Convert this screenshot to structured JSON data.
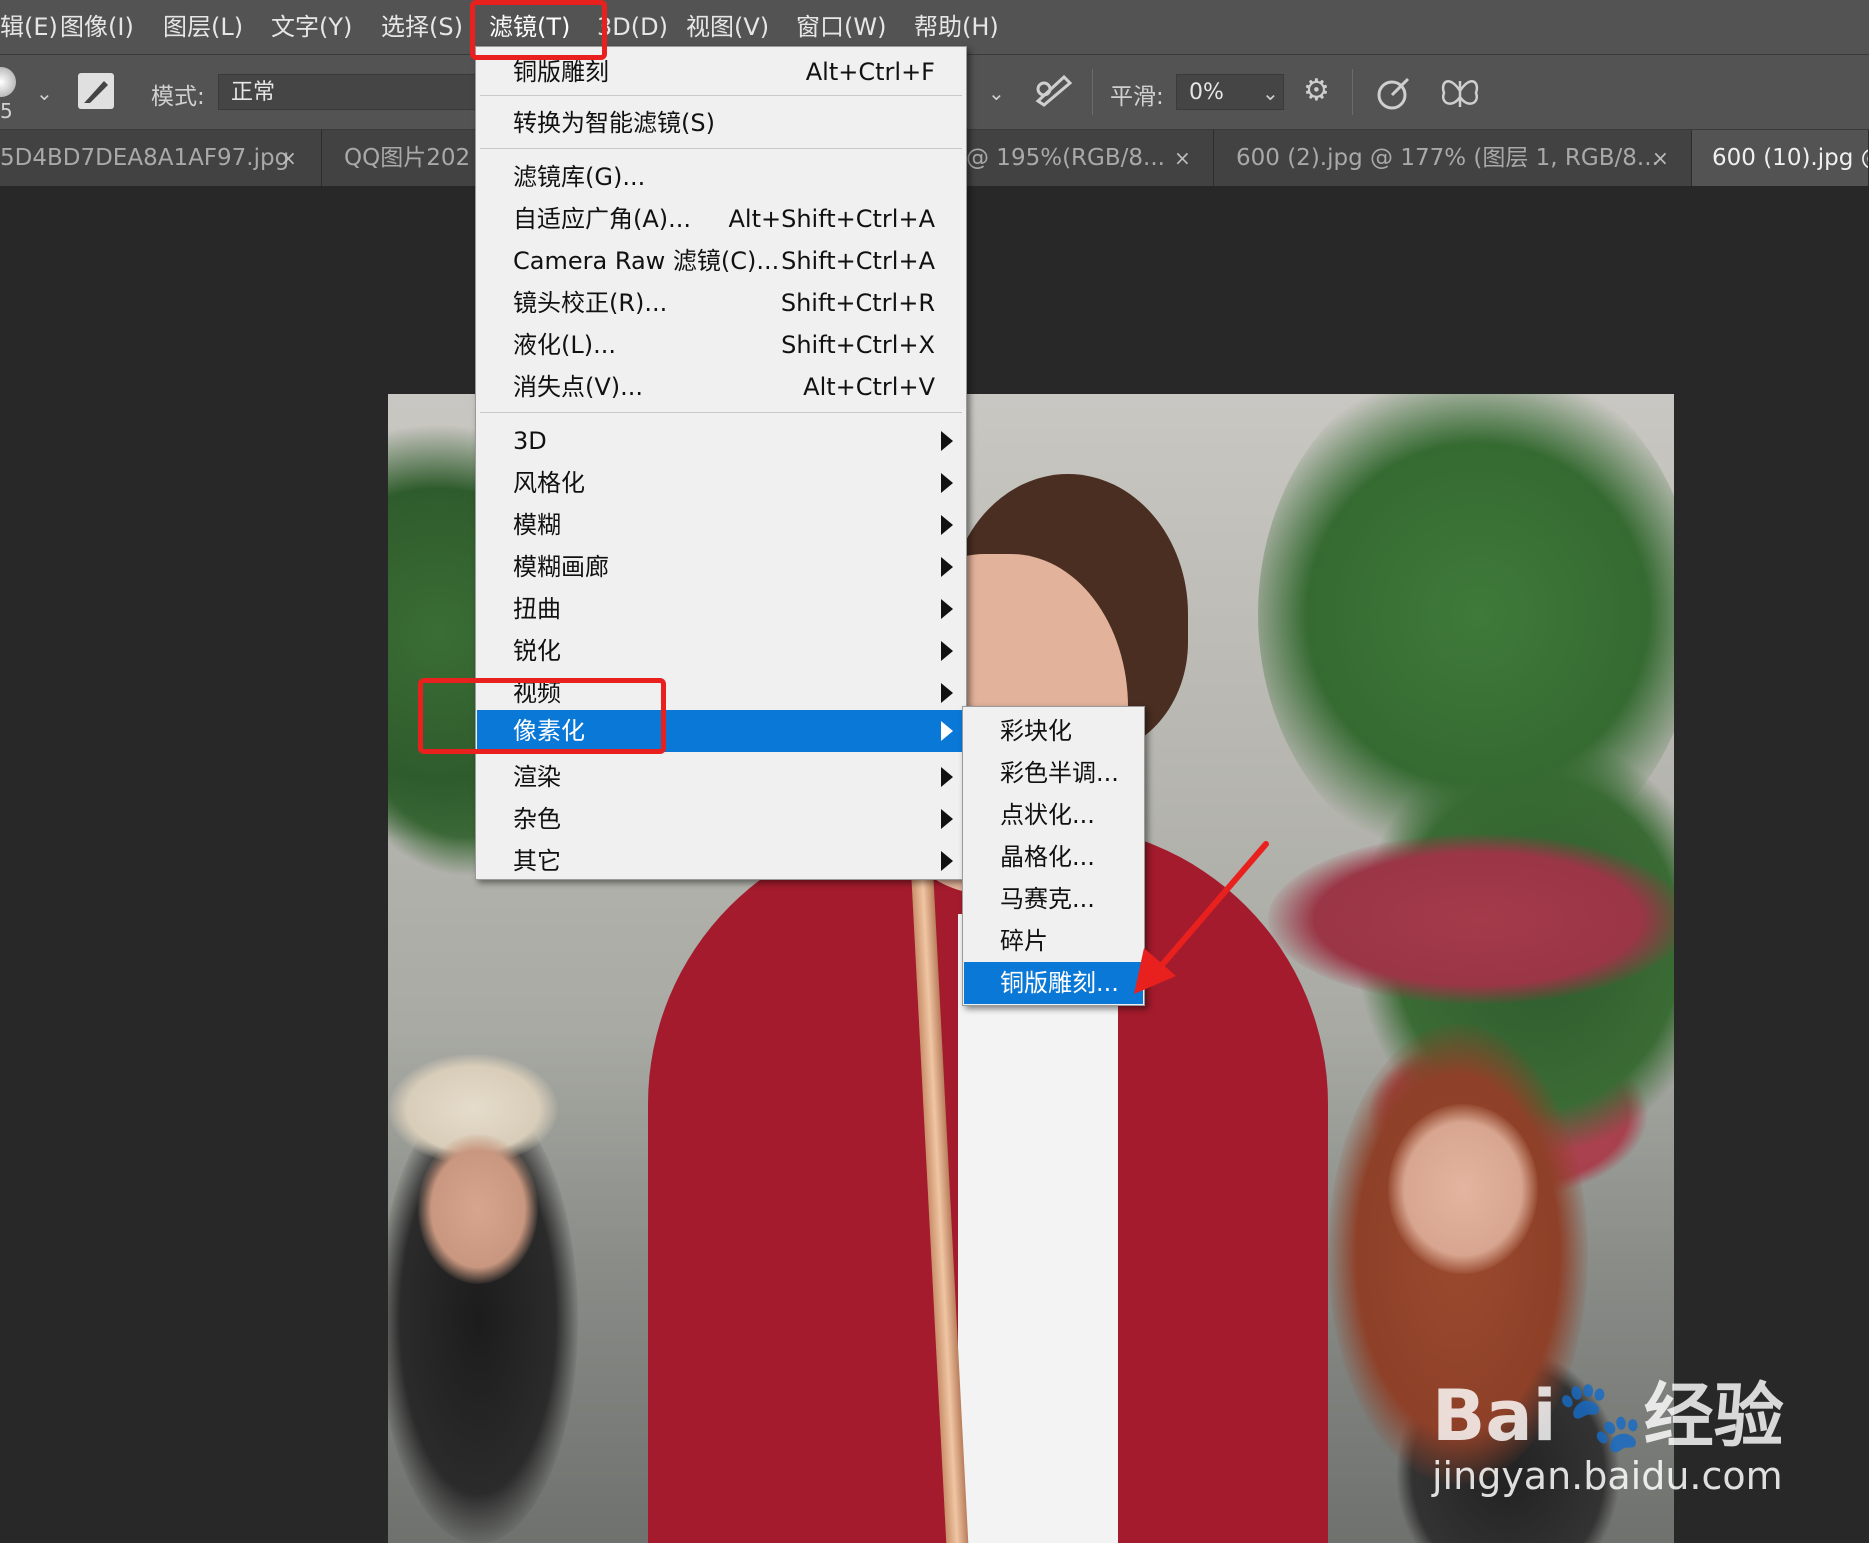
{
  "menubar": {
    "items": [
      {
        "label": "辑(E)"
      },
      {
        "label": "图像(I)"
      },
      {
        "label": "图层(L)"
      },
      {
        "label": "文字(Y)"
      },
      {
        "label": "选择(S)"
      },
      {
        "label": "滤镜(T)"
      },
      {
        "label": "3D(D)"
      },
      {
        "label": "视图(V)"
      },
      {
        "label": "窗口(W)"
      },
      {
        "label": "帮助(H)"
      }
    ]
  },
  "options": {
    "brush_size": "5",
    "mode_label": "模式:",
    "mode_value": "正常",
    "smoothing_label": "平滑:",
    "smoothing_value": "0%"
  },
  "tabs": [
    {
      "title": "5D4BD7DEA8A1AF97.jpg",
      "close": "×"
    },
    {
      "title": "QQ图片202",
      "close": ""
    },
    {
      "title": "@ 195%(RGB/8...",
      "close": "×"
    },
    {
      "title": "600 (2).jpg @ 177% (图层 1, RGB/8...",
      "close": "×"
    },
    {
      "title": "600 (10).jpg @",
      "close": ""
    }
  ],
  "filter_menu": {
    "last_filter": {
      "label": "铜版雕刻",
      "shortcut": "Alt+Ctrl+F"
    },
    "convert_smart": {
      "label": "转换为智能滤镜(S)"
    },
    "group2": [
      {
        "label": "滤镜库(G)...",
        "shortcut": ""
      },
      {
        "label": "自适应广角(A)...",
        "shortcut": "Alt+Shift+Ctrl+A"
      },
      {
        "label": "Camera Raw 滤镜(C)...",
        "shortcut": "Shift+Ctrl+A"
      },
      {
        "label": "镜头校正(R)...",
        "shortcut": "Shift+Ctrl+R"
      },
      {
        "label": "液化(L)...",
        "shortcut": "Shift+Ctrl+X"
      },
      {
        "label": "消失点(V)...",
        "shortcut": "Alt+Ctrl+V"
      }
    ],
    "submenus": [
      {
        "label": "3D"
      },
      {
        "label": "风格化"
      },
      {
        "label": "模糊"
      },
      {
        "label": "模糊画廊"
      },
      {
        "label": "扭曲"
      },
      {
        "label": "锐化"
      },
      {
        "label": "视频"
      },
      {
        "label": "像素化"
      },
      {
        "label": "渲染"
      },
      {
        "label": "杂色"
      },
      {
        "label": "其它"
      }
    ],
    "highlighted": "像素化"
  },
  "pixelate_submenu": {
    "items": [
      {
        "label": "彩块化"
      },
      {
        "label": "彩色半调..."
      },
      {
        "label": "点状化..."
      },
      {
        "label": "晶格化..."
      },
      {
        "label": "马赛克..."
      },
      {
        "label": "碎片"
      },
      {
        "label": "铜版雕刻..."
      }
    ],
    "highlighted": "铜版雕刻..."
  },
  "watermark": {
    "brand": "Bai🐾经验",
    "url": "jingyan.baidu.com"
  },
  "colors": {
    "highlight": "#0a78d7",
    "annotation_red": "#e8211f",
    "menubar_bg": "#535353",
    "workspace_bg": "#282828"
  }
}
